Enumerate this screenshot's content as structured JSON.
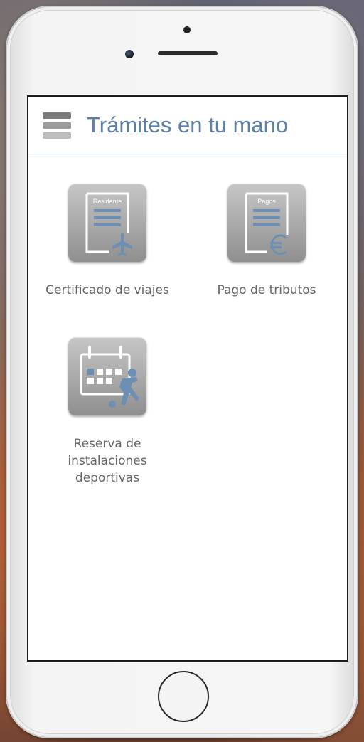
{
  "app": {
    "title": "Trámites en tu mano"
  },
  "tiles": [
    {
      "label": "Certificado de viajes",
      "doc_caption": "Residente",
      "icon": "travel-certificate-icon",
      "badge_icon": "airplane-icon"
    },
    {
      "label": "Pago de tributos",
      "doc_caption": "Pagos",
      "icon": "tax-payment-icon",
      "badge_icon": "euro-icon"
    },
    {
      "label": "Reserva de instalaciones deportivas",
      "icon": "sports-booking-icon",
      "badge_icon": "soccer-player-icon"
    }
  ],
  "colors": {
    "title": "#5b7fa7",
    "accent_blue": "#6e8fb4",
    "tile_gray": "#a8a8a8",
    "label_gray": "#666666"
  }
}
